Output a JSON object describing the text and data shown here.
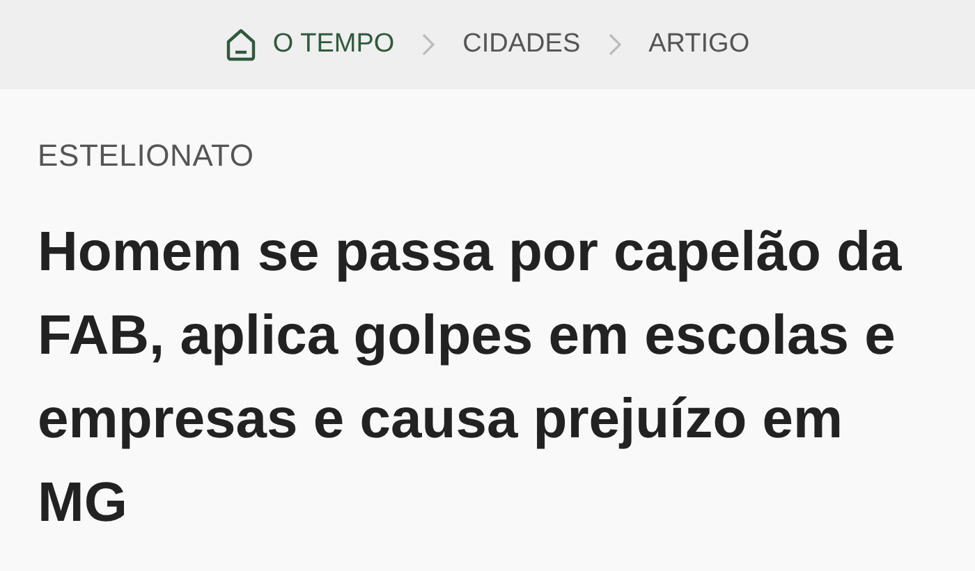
{
  "breadcrumb": [
    {
      "kind": "home",
      "label": "O TEMPO"
    },
    {
      "kind": "page",
      "label": "CIDADES"
    },
    {
      "kind": "page",
      "label": "ARTIGO"
    }
  ],
  "article": {
    "category": "ESTELIONATO",
    "headline": "Homem se passa por capelão da FAB, aplica golpes em escolas e empresas e causa prejuízo em MG"
  }
}
